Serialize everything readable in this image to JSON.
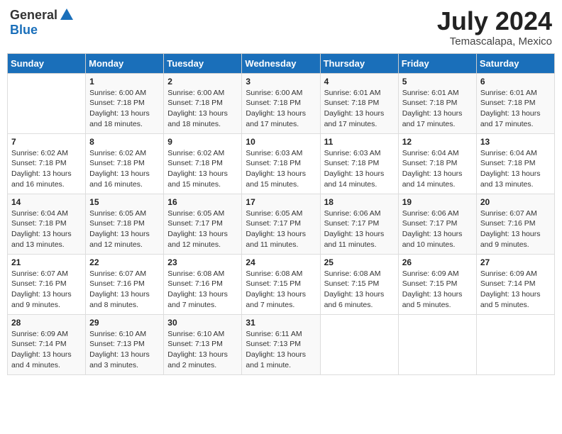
{
  "header": {
    "logo_general": "General",
    "logo_blue": "Blue",
    "month_year": "July 2024",
    "location": "Temascalapa, Mexico"
  },
  "days_of_week": [
    "Sunday",
    "Monday",
    "Tuesday",
    "Wednesday",
    "Thursday",
    "Friday",
    "Saturday"
  ],
  "weeks": [
    [
      {
        "day": "",
        "info": ""
      },
      {
        "day": "1",
        "info": "Sunrise: 6:00 AM\nSunset: 7:18 PM\nDaylight: 13 hours\nand 18 minutes."
      },
      {
        "day": "2",
        "info": "Sunrise: 6:00 AM\nSunset: 7:18 PM\nDaylight: 13 hours\nand 18 minutes."
      },
      {
        "day": "3",
        "info": "Sunrise: 6:00 AM\nSunset: 7:18 PM\nDaylight: 13 hours\nand 17 minutes."
      },
      {
        "day": "4",
        "info": "Sunrise: 6:01 AM\nSunset: 7:18 PM\nDaylight: 13 hours\nand 17 minutes."
      },
      {
        "day": "5",
        "info": "Sunrise: 6:01 AM\nSunset: 7:18 PM\nDaylight: 13 hours\nand 17 minutes."
      },
      {
        "day": "6",
        "info": "Sunrise: 6:01 AM\nSunset: 7:18 PM\nDaylight: 13 hours\nand 17 minutes."
      }
    ],
    [
      {
        "day": "7",
        "info": "Sunrise: 6:02 AM\nSunset: 7:18 PM\nDaylight: 13 hours\nand 16 minutes."
      },
      {
        "day": "8",
        "info": "Sunrise: 6:02 AM\nSunset: 7:18 PM\nDaylight: 13 hours\nand 16 minutes."
      },
      {
        "day": "9",
        "info": "Sunrise: 6:02 AM\nSunset: 7:18 PM\nDaylight: 13 hours\nand 15 minutes."
      },
      {
        "day": "10",
        "info": "Sunrise: 6:03 AM\nSunset: 7:18 PM\nDaylight: 13 hours\nand 15 minutes."
      },
      {
        "day": "11",
        "info": "Sunrise: 6:03 AM\nSunset: 7:18 PM\nDaylight: 13 hours\nand 14 minutes."
      },
      {
        "day": "12",
        "info": "Sunrise: 6:04 AM\nSunset: 7:18 PM\nDaylight: 13 hours\nand 14 minutes."
      },
      {
        "day": "13",
        "info": "Sunrise: 6:04 AM\nSunset: 7:18 PM\nDaylight: 13 hours\nand 13 minutes."
      }
    ],
    [
      {
        "day": "14",
        "info": "Sunrise: 6:04 AM\nSunset: 7:18 PM\nDaylight: 13 hours\nand 13 minutes."
      },
      {
        "day": "15",
        "info": "Sunrise: 6:05 AM\nSunset: 7:18 PM\nDaylight: 13 hours\nand 12 minutes."
      },
      {
        "day": "16",
        "info": "Sunrise: 6:05 AM\nSunset: 7:17 PM\nDaylight: 13 hours\nand 12 minutes."
      },
      {
        "day": "17",
        "info": "Sunrise: 6:05 AM\nSunset: 7:17 PM\nDaylight: 13 hours\nand 11 minutes."
      },
      {
        "day": "18",
        "info": "Sunrise: 6:06 AM\nSunset: 7:17 PM\nDaylight: 13 hours\nand 11 minutes."
      },
      {
        "day": "19",
        "info": "Sunrise: 6:06 AM\nSunset: 7:17 PM\nDaylight: 13 hours\nand 10 minutes."
      },
      {
        "day": "20",
        "info": "Sunrise: 6:07 AM\nSunset: 7:16 PM\nDaylight: 13 hours\nand 9 minutes."
      }
    ],
    [
      {
        "day": "21",
        "info": "Sunrise: 6:07 AM\nSunset: 7:16 PM\nDaylight: 13 hours\nand 9 minutes."
      },
      {
        "day": "22",
        "info": "Sunrise: 6:07 AM\nSunset: 7:16 PM\nDaylight: 13 hours\nand 8 minutes."
      },
      {
        "day": "23",
        "info": "Sunrise: 6:08 AM\nSunset: 7:16 PM\nDaylight: 13 hours\nand 7 minutes."
      },
      {
        "day": "24",
        "info": "Sunrise: 6:08 AM\nSunset: 7:15 PM\nDaylight: 13 hours\nand 7 minutes."
      },
      {
        "day": "25",
        "info": "Sunrise: 6:08 AM\nSunset: 7:15 PM\nDaylight: 13 hours\nand 6 minutes."
      },
      {
        "day": "26",
        "info": "Sunrise: 6:09 AM\nSunset: 7:15 PM\nDaylight: 13 hours\nand 5 minutes."
      },
      {
        "day": "27",
        "info": "Sunrise: 6:09 AM\nSunset: 7:14 PM\nDaylight: 13 hours\nand 5 minutes."
      }
    ],
    [
      {
        "day": "28",
        "info": "Sunrise: 6:09 AM\nSunset: 7:14 PM\nDaylight: 13 hours\nand 4 minutes."
      },
      {
        "day": "29",
        "info": "Sunrise: 6:10 AM\nSunset: 7:13 PM\nDaylight: 13 hours\nand 3 minutes."
      },
      {
        "day": "30",
        "info": "Sunrise: 6:10 AM\nSunset: 7:13 PM\nDaylight: 13 hours\nand 2 minutes."
      },
      {
        "day": "31",
        "info": "Sunrise: 6:11 AM\nSunset: 7:13 PM\nDaylight: 13 hours\nand 1 minute."
      },
      {
        "day": "",
        "info": ""
      },
      {
        "day": "",
        "info": ""
      },
      {
        "day": "",
        "info": ""
      }
    ]
  ]
}
